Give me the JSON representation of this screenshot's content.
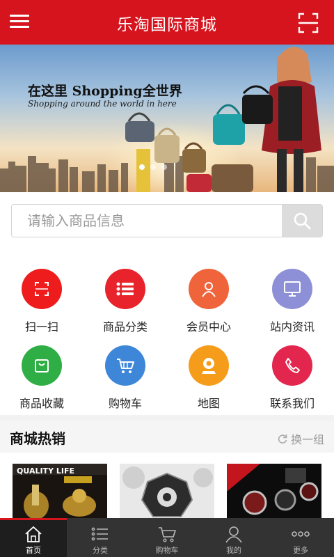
{
  "header": {
    "title": "乐淘国际商城"
  },
  "banner": {
    "headline": "在这里 Shopping全世界",
    "tagline": "Shopping around the world in here"
  },
  "search": {
    "placeholder": "请输入商品信息"
  },
  "menu": [
    {
      "label": "扫一扫",
      "color": "#ee1c1c",
      "icon": "scan-icon"
    },
    {
      "label": "商品分类",
      "color": "#e8232b",
      "icon": "list-icon"
    },
    {
      "label": "会员中心",
      "color": "#f0643c",
      "icon": "user-icon"
    },
    {
      "label": "站内资讯",
      "color": "#8d90d6",
      "icon": "monitor-icon"
    },
    {
      "label": "商品收藏",
      "color": "#2fae46",
      "icon": "bag-icon"
    },
    {
      "label": "购物车",
      "color": "#3d86d8",
      "icon": "cart-icon"
    },
    {
      "label": "地图",
      "color": "#f59c1a",
      "icon": "map-pin-icon"
    },
    {
      "label": "联系我们",
      "color": "#e2264d",
      "icon": "phone-icon"
    }
  ],
  "hot": {
    "title": "商城热销",
    "refresh": "换一组",
    "products": [
      {
        "caption": "QUALITY LIFE"
      },
      {
        "caption": ""
      },
      {
        "caption": ""
      }
    ]
  },
  "tabs": [
    {
      "label": "首页",
      "icon": "home-icon"
    },
    {
      "label": "分类",
      "icon": "list-icon"
    },
    {
      "label": "购物车",
      "icon": "cart-icon"
    },
    {
      "label": "我的",
      "icon": "user-icon"
    },
    {
      "label": "更多",
      "icon": "more-icon"
    }
  ],
  "colors": {
    "brand": "#d6141e",
    "tabbar": "#333333"
  }
}
